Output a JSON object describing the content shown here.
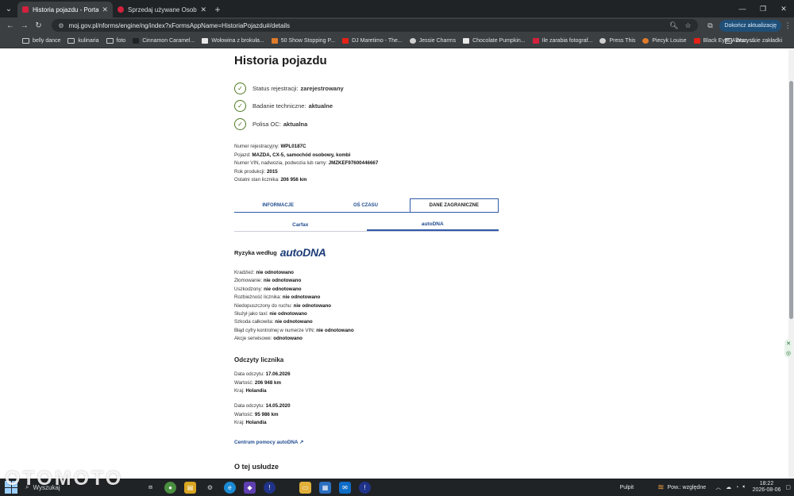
{
  "browser": {
    "tabs": [
      {
        "title": "Historia pojazdu - Portal gov.pl",
        "active": true,
        "favicon_color": "#d4213d"
      },
      {
        "title": "Sprzedaj używane Osobowe | O",
        "active": false,
        "favicon_color": "#d4213d"
      }
    ],
    "url": "moj.gov.pl/nforms/engine/ng/index?xFormsAppName=HistoriaPojazdu#/details",
    "update_button": "Dokończ aktualizację",
    "bookmarks": [
      {
        "label": "belly dance",
        "type": "folder"
      },
      {
        "label": "kulinaria",
        "type": "folder"
      },
      {
        "label": "foto",
        "type": "folder"
      },
      {
        "label": "Cinnamon Caramel...",
        "type": "site",
        "color": "#222222"
      },
      {
        "label": "Wołowina z brokuła...",
        "type": "site",
        "color": "#e8e8e8"
      },
      {
        "label": "50 Show Stopping P...",
        "type": "site",
        "color": "#e07b2a"
      },
      {
        "label": "DJ Maretimo - The...",
        "type": "site",
        "color": "#e62117"
      },
      {
        "label": "Jessie Charms",
        "type": "site",
        "color": "#cfcfcf"
      },
      {
        "label": "Chocolate Pumpkin...",
        "type": "site",
        "color": "#e8e8e8"
      },
      {
        "label": "Ile zarabia fotograf...",
        "type": "site",
        "color": "#d4213d"
      },
      {
        "label": "Press This",
        "type": "site",
        "color": "#cfcfcf"
      },
      {
        "label": "Piecyk Louise",
        "type": "site",
        "color": "#e07b2a"
      },
      {
        "label": "Black Eyes Album -...",
        "type": "site",
        "color": "#e62117"
      }
    ],
    "all_bookmarks": "Wszystkie zakładki"
  },
  "page": {
    "title": "Historia pojazdu",
    "statuses": [
      {
        "label": "Status rejestracji:",
        "value": "zarejestrowany"
      },
      {
        "label": "Badanie techniczne:",
        "value": "aktualne"
      },
      {
        "label": "Polisa OC:",
        "value": "aktualna"
      }
    ],
    "vehicle_info": [
      {
        "label": "Numer rejestracyjny:",
        "value": "WPL0187C"
      },
      {
        "label": "Pojazd:",
        "value": "MAZDA, CX-5, samochód osobowy, kombi"
      },
      {
        "label": "Numer VIN, nadwozia, podwozia lub ramy:",
        "value": "JMZKEF97600446667"
      },
      {
        "label": "Rok produkcji:",
        "value": "2015"
      },
      {
        "label": "Ostatni stan licznika:",
        "value": "206 956 km"
      }
    ],
    "main_tabs": [
      "INFORMACJE",
      "OŚ CZASU",
      "DANE ZAGRANICZNE"
    ],
    "sub_tabs": [
      "Carfax",
      "autoDNA"
    ],
    "risk_heading": "Ryzyka według",
    "risk_brand": "autoDNA",
    "risks": [
      {
        "label": "Kradzież:",
        "value": "nie odnotowano"
      },
      {
        "label": "Złomowanie:",
        "value": "nie odnotowano"
      },
      {
        "label": "Uszkodzony:",
        "value": "nie odnotowano"
      },
      {
        "label": "Rozbieżność licznika:",
        "value": "nie odnotowano"
      },
      {
        "label": "Niedopuszczony do ruchu:",
        "value": "nie odnotowano"
      },
      {
        "label": "Służył jako taxi:",
        "value": "nie odnotowano"
      },
      {
        "label": "Szkoda całkowita:",
        "value": "nie odnotowano"
      },
      {
        "label": "Błąd cyfry kontrolnej w numerze VIN:",
        "value": "nie odnotowano"
      },
      {
        "label": "Akcje serwisowe:",
        "value": "odnotowano"
      }
    ],
    "odometer_heading": "Odczyty licznika",
    "readings": [
      {
        "date_label": "Data odczytu:",
        "date": "17.06.2026",
        "value_label": "Wartość:",
        "value": "206 948 km",
        "country_label": "Kraj:",
        "country": "Holandia"
      },
      {
        "date_label": "Data odczytu:",
        "date": "14.05.2020",
        "value_label": "Wartość:",
        "value": "95 986 km",
        "country_label": "Kraj:",
        "country": "Holandia"
      }
    ],
    "help_link": "Centrum pomocy autoDNA",
    "about_heading": "O tej usłudze"
  },
  "taskbar": {
    "search": "Wyszukaj",
    "desktop": "Pulpit",
    "weather": "Pow.: względne",
    "time": "18:22",
    "date": "2026-08-06"
  },
  "watermark": "OTOMOTO"
}
